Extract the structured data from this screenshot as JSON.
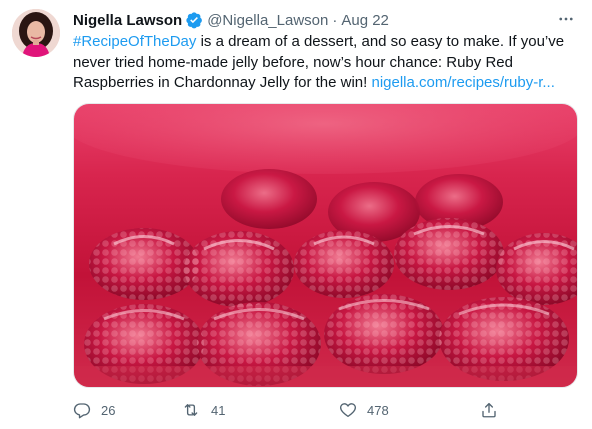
{
  "author": {
    "name": "Nigella Lawson",
    "handle": "@Nigella_Lawson",
    "separator": "·",
    "date": "Aug 22"
  },
  "tweet": {
    "hashtag": "#RecipeOfTheDay",
    "body": " is a dream of a dessert, and so easy to make. If you’ve never tried home-made jelly before, now’s hour chance: Ruby Red Raspberries in Chardonnay Jelly for the win! ",
    "link": "nigella.com/recipes/ruby-r..."
  },
  "actions": {
    "replies": "26",
    "retweets": "41",
    "likes": "478"
  },
  "icons": {
    "verified": "verified-badge-icon",
    "more": "more-icon",
    "reply": "reply-icon",
    "retweet": "retweet-icon",
    "like": "heart-icon",
    "share": "share-icon"
  },
  "colors": {
    "accent": "#1d9bf0",
    "text": "#0f1419",
    "secondary": "#536471"
  }
}
